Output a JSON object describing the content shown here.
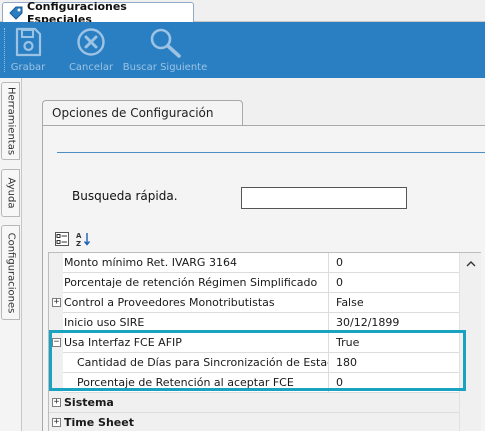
{
  "window": {
    "tab_title": "Configuraciones Especiales"
  },
  "toolbar": {
    "buttons": [
      {
        "label": "Grabar",
        "icon": "save-icon"
      },
      {
        "label": "Cancelar",
        "icon": "cancel-icon"
      },
      {
        "label": "Buscar Siguiente",
        "icon": "search-icon"
      }
    ]
  },
  "side_tabs": [
    {
      "label": "Herramientas"
    },
    {
      "label": "Ayuda"
    },
    {
      "label": "Configuraciones"
    }
  ],
  "panel": {
    "tab_label": "Opciones de Configuración",
    "search_label": "Busqueda rápida.",
    "search_value": ""
  },
  "grid": {
    "toolbar_icons": [
      "categorized-icon",
      "alphabetical-sort-icon"
    ],
    "rows": [
      {
        "name": "Monto mínimo Ret. IVARG 3164",
        "value": "0"
      },
      {
        "name": "Porcentaje de retención Régimen Simplificado",
        "value": "0"
      },
      {
        "name": "Control a Proveedores Monotributistas",
        "value": "False",
        "expander": "+"
      },
      {
        "name": "Inicio uso SIRE",
        "value": "30/12/1899"
      },
      {
        "name": "Usa Interfaz FCE AFIP",
        "value": "True",
        "expander": "−"
      },
      {
        "name": "Cantidad de Días para Sincronización de Estados",
        "value": "180",
        "child": true
      },
      {
        "name": "Porcentaje de Retención al aceptar FCE",
        "value": "0",
        "child": true
      }
    ],
    "categories": [
      {
        "name": "Sistema",
        "expander": "+"
      },
      {
        "name": "Time Sheet",
        "expander": "+"
      }
    ]
  },
  "colors": {
    "toolbar_bg": "#2a7fc2",
    "highlight_border": "#19a3c0",
    "accent_line": "#4e8cc4"
  }
}
